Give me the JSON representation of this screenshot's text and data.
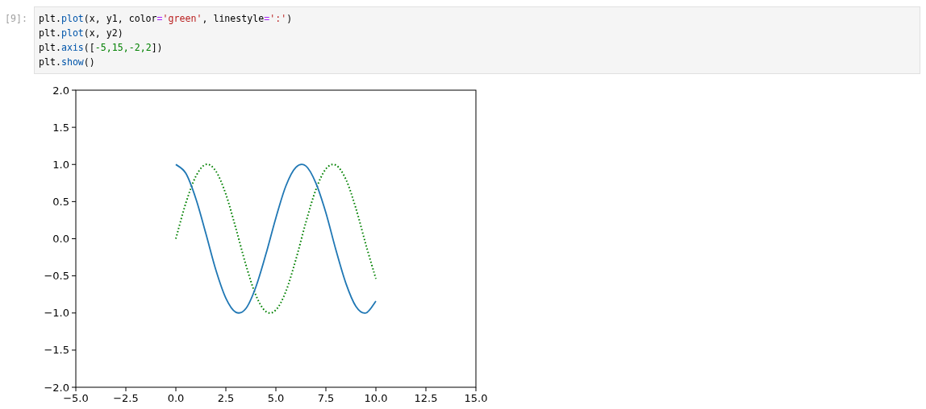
{
  "cell": {
    "prompt": "[9]:",
    "code_lines": [
      [
        {
          "text": "plt.",
          "kind": "plain"
        },
        {
          "text": "plot",
          "kind": "property"
        },
        {
          "text": "(x, y1, color",
          "kind": "plain"
        },
        {
          "text": "=",
          "kind": "operator"
        },
        {
          "text": "'green'",
          "kind": "string"
        },
        {
          "text": ", linestyle",
          "kind": "plain"
        },
        {
          "text": "=",
          "kind": "operator"
        },
        {
          "text": "':'",
          "kind": "string"
        },
        {
          "text": ")",
          "kind": "plain"
        }
      ],
      [
        {
          "text": "plt.",
          "kind": "plain"
        },
        {
          "text": "plot",
          "kind": "property"
        },
        {
          "text": "(x, y2)",
          "kind": "plain"
        }
      ],
      [
        {
          "text": "plt.",
          "kind": "plain"
        },
        {
          "text": "axis",
          "kind": "property"
        },
        {
          "text": "([",
          "kind": "plain"
        },
        {
          "text": "-5,15,-2,2",
          "kind": "number"
        },
        {
          "text": "])",
          "kind": "plain"
        }
      ],
      [
        {
          "text": "plt.",
          "kind": "plain"
        },
        {
          "text": "show",
          "kind": "property"
        },
        {
          "text": "()",
          "kind": "plain"
        }
      ]
    ],
    "output": {
      "chart_data": {
        "type": "line",
        "x": [
          0,
          0.5,
          1,
          1.5,
          2,
          2.5,
          3,
          3.5,
          4,
          4.5,
          5,
          5.5,
          6,
          6.5,
          7,
          7.5,
          8,
          8.5,
          9,
          9.5,
          10
        ],
        "series": [
          {
            "color": "#008000",
            "line_style": "dotted",
            "values": [
              0,
              0.48,
              0.84,
              1,
              0.91,
              0.6,
              0.14,
              -0.35,
              -0.76,
              -0.98,
              -0.96,
              -0.71,
              -0.28,
              0.22,
              0.66,
              0.94,
              0.99,
              0.8,
              0.41,
              -0.08,
              -0.54
            ]
          },
          {
            "color": "#1f77b4",
            "line_style": "solid",
            "values": [
              1,
              0.88,
              0.54,
              0.07,
              -0.42,
              -0.8,
              -0.99,
              -0.94,
              -0.65,
              -0.21,
              0.28,
              0.71,
              0.96,
              0.98,
              0.75,
              0.35,
              -0.15,
              -0.6,
              -0.91,
              -1,
              -0.84
            ]
          }
        ],
        "xlim": [
          -5,
          15
        ],
        "ylim": [
          -2,
          2
        ],
        "xticks": [
          {
            "value": -5,
            "label": "−5.0"
          },
          {
            "value": -2.5,
            "label": "−2.5"
          },
          {
            "value": 0,
            "label": "0.0"
          },
          {
            "value": 2.5,
            "label": "2.5"
          },
          {
            "value": 5,
            "label": "5.0"
          },
          {
            "value": 7.5,
            "label": "7.5"
          },
          {
            "value": 10,
            "label": "10.0"
          },
          {
            "value": 12.5,
            "label": "12.5"
          },
          {
            "value": 15,
            "label": "15.0"
          }
        ],
        "yticks": [
          {
            "value": 2,
            "label": "2.0"
          },
          {
            "value": 1.5,
            "label": "1.5"
          },
          {
            "value": 1,
            "label": "1.0"
          },
          {
            "value": 0.5,
            "label": "0.5"
          },
          {
            "value": 0,
            "label": "0.0"
          },
          {
            "value": -0.5,
            "label": "−0.5"
          },
          {
            "value": -1,
            "label": "−1.0"
          },
          {
            "value": -1.5,
            "label": "−1.5"
          },
          {
            "value": -2,
            "label": "−2.0"
          }
        ]
      }
    }
  }
}
